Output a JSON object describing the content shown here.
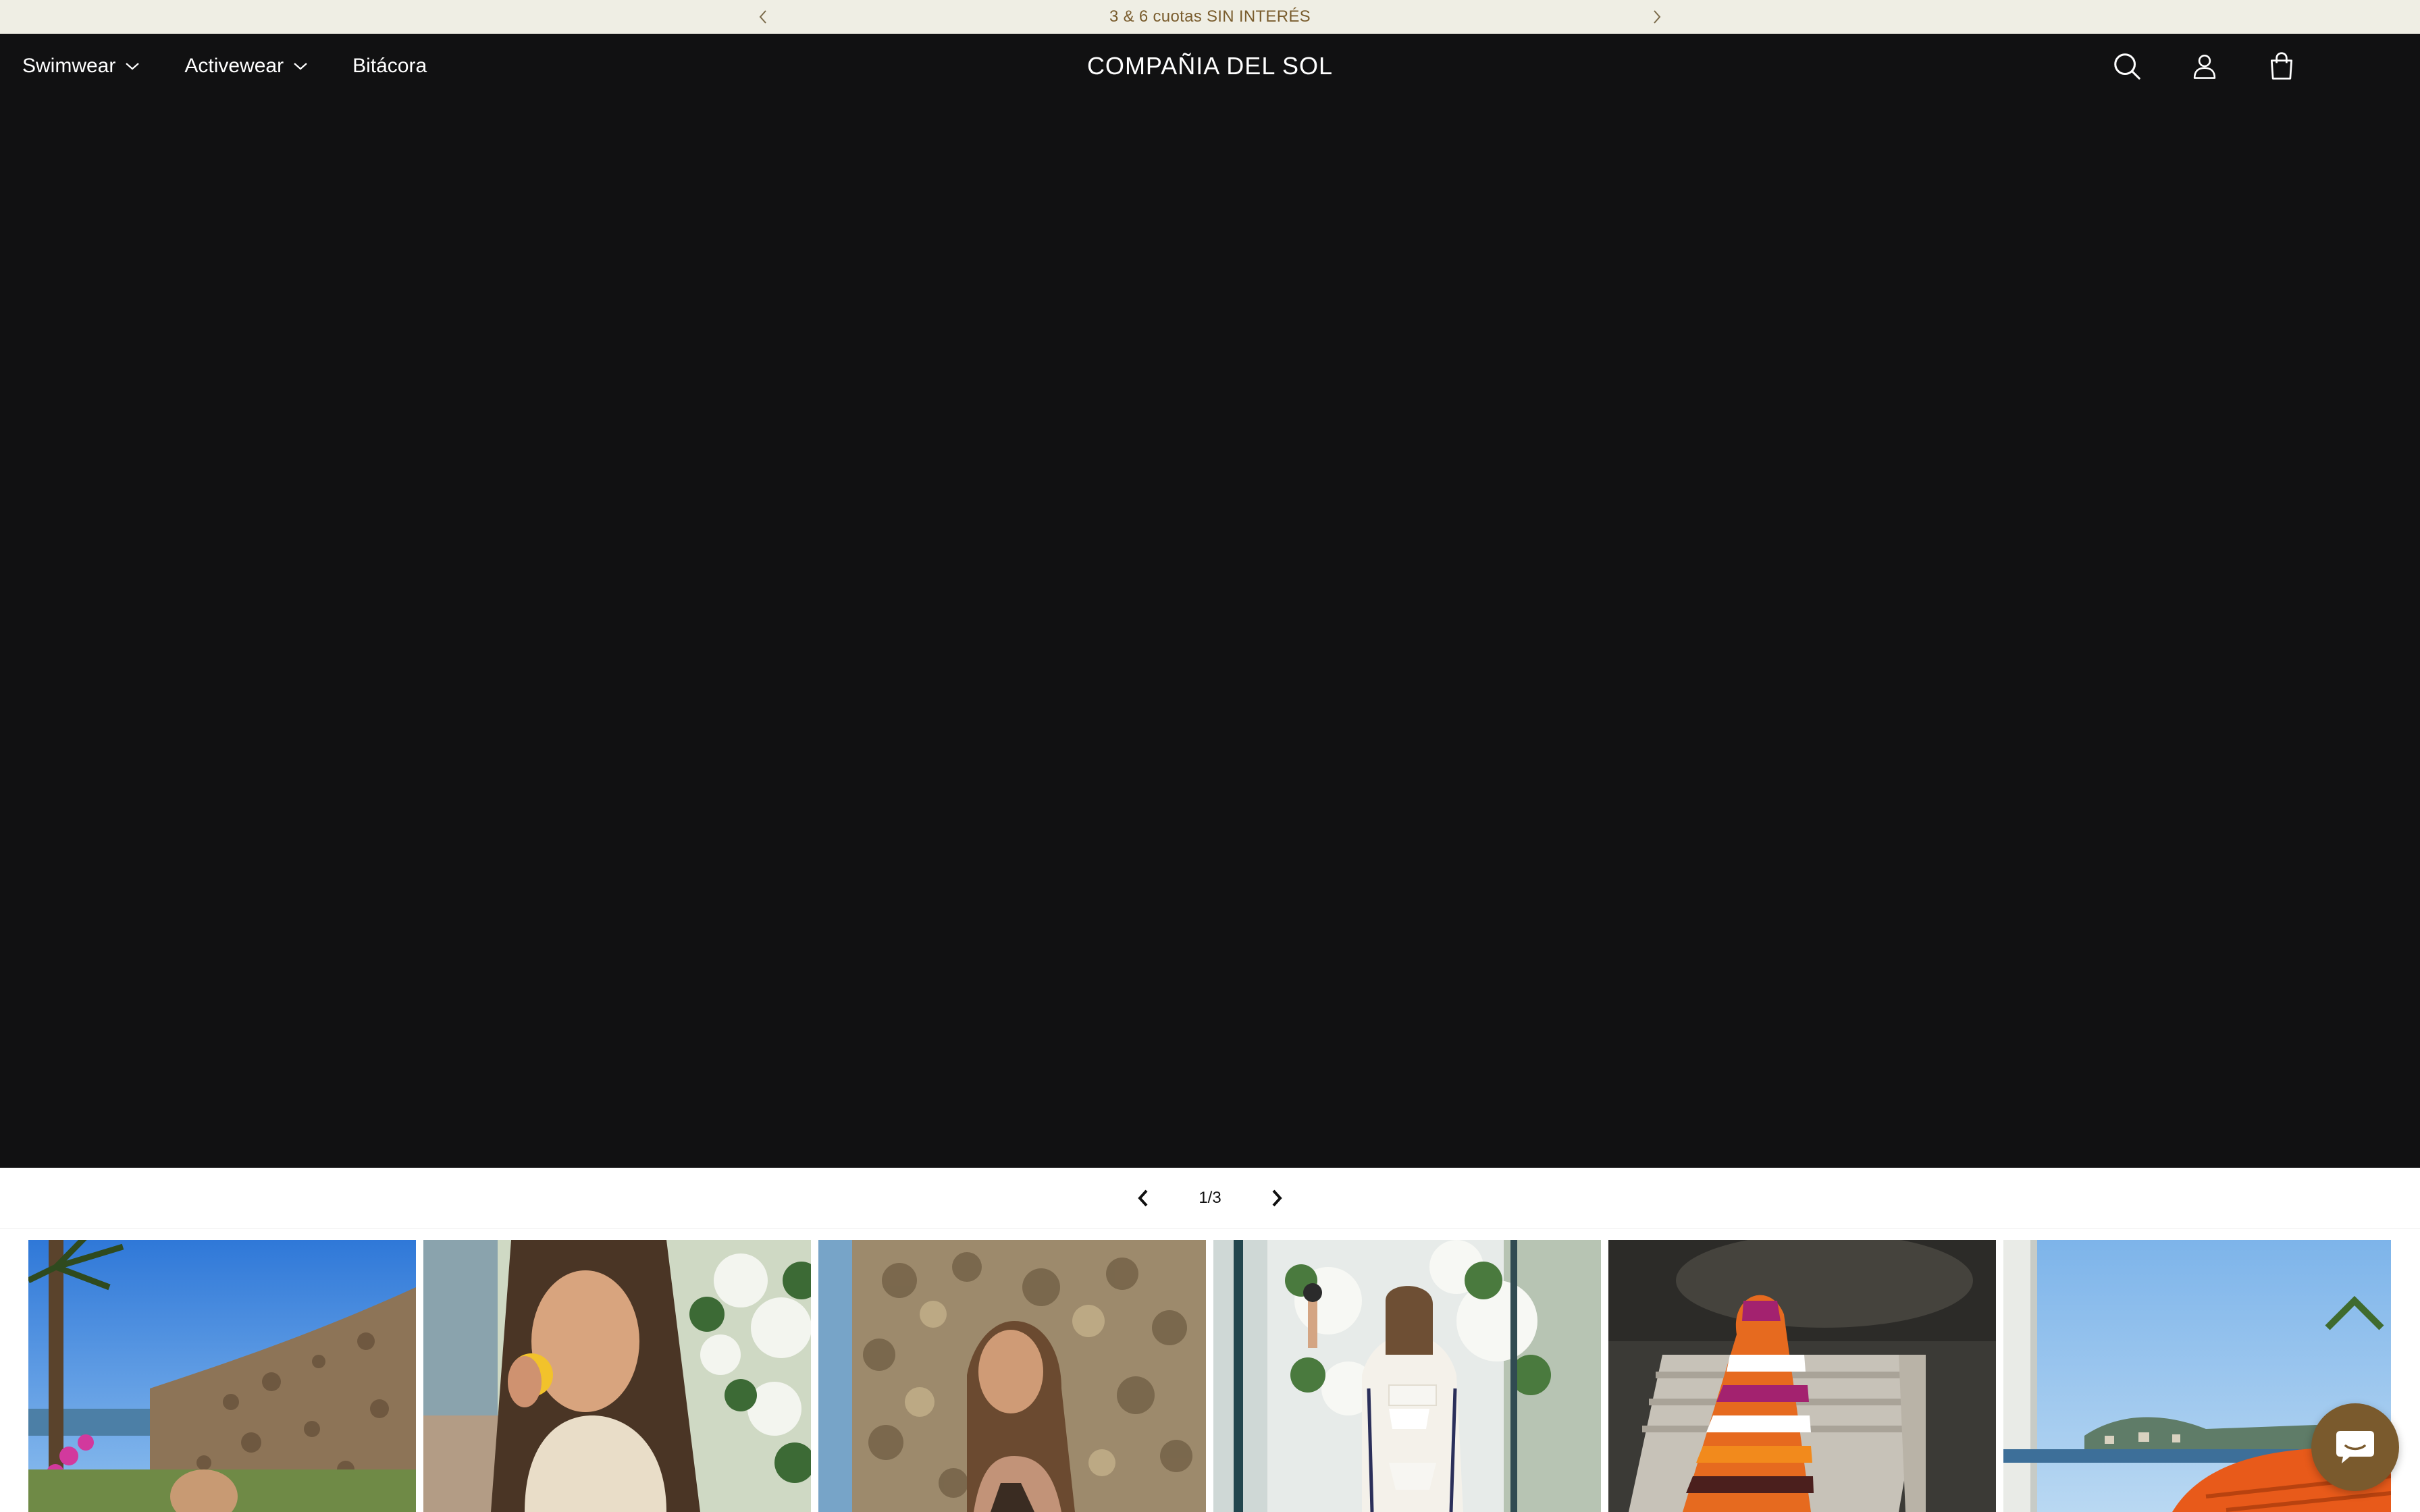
{
  "announcement": {
    "text": "3 & 6 cuotas SIN INTERÉS"
  },
  "header": {
    "nav": [
      {
        "label": "Swimwear",
        "has_dropdown": true
      },
      {
        "label": "Activewear",
        "has_dropdown": true
      },
      {
        "label": "Bitácora",
        "has_dropdown": false
      }
    ],
    "logo": "COMPAÑIA DEL SOL",
    "icons": [
      "search-icon",
      "account-icon",
      "cart-icon"
    ]
  },
  "slider": {
    "counter": "1/3"
  },
  "gallery": {
    "items": [
      {
        "name": "gallery-image-1",
        "scene": "palm-stone-wall"
      },
      {
        "name": "gallery-image-2",
        "scene": "woman-eating-fruit"
      },
      {
        "name": "gallery-image-3",
        "scene": "stone-wall-portrait"
      },
      {
        "name": "gallery-image-4",
        "scene": "doorway-white-cardigan"
      },
      {
        "name": "gallery-image-5",
        "scene": "striped-knit-bag-chair"
      },
      {
        "name": "gallery-image-6",
        "scene": "orange-knit-seaside"
      }
    ]
  },
  "colors": {
    "announcement_bg": "#efeee4",
    "announcement_text": "#7a5d2e",
    "header_bg": "#111112",
    "chat_button": "#7a5a2d"
  }
}
